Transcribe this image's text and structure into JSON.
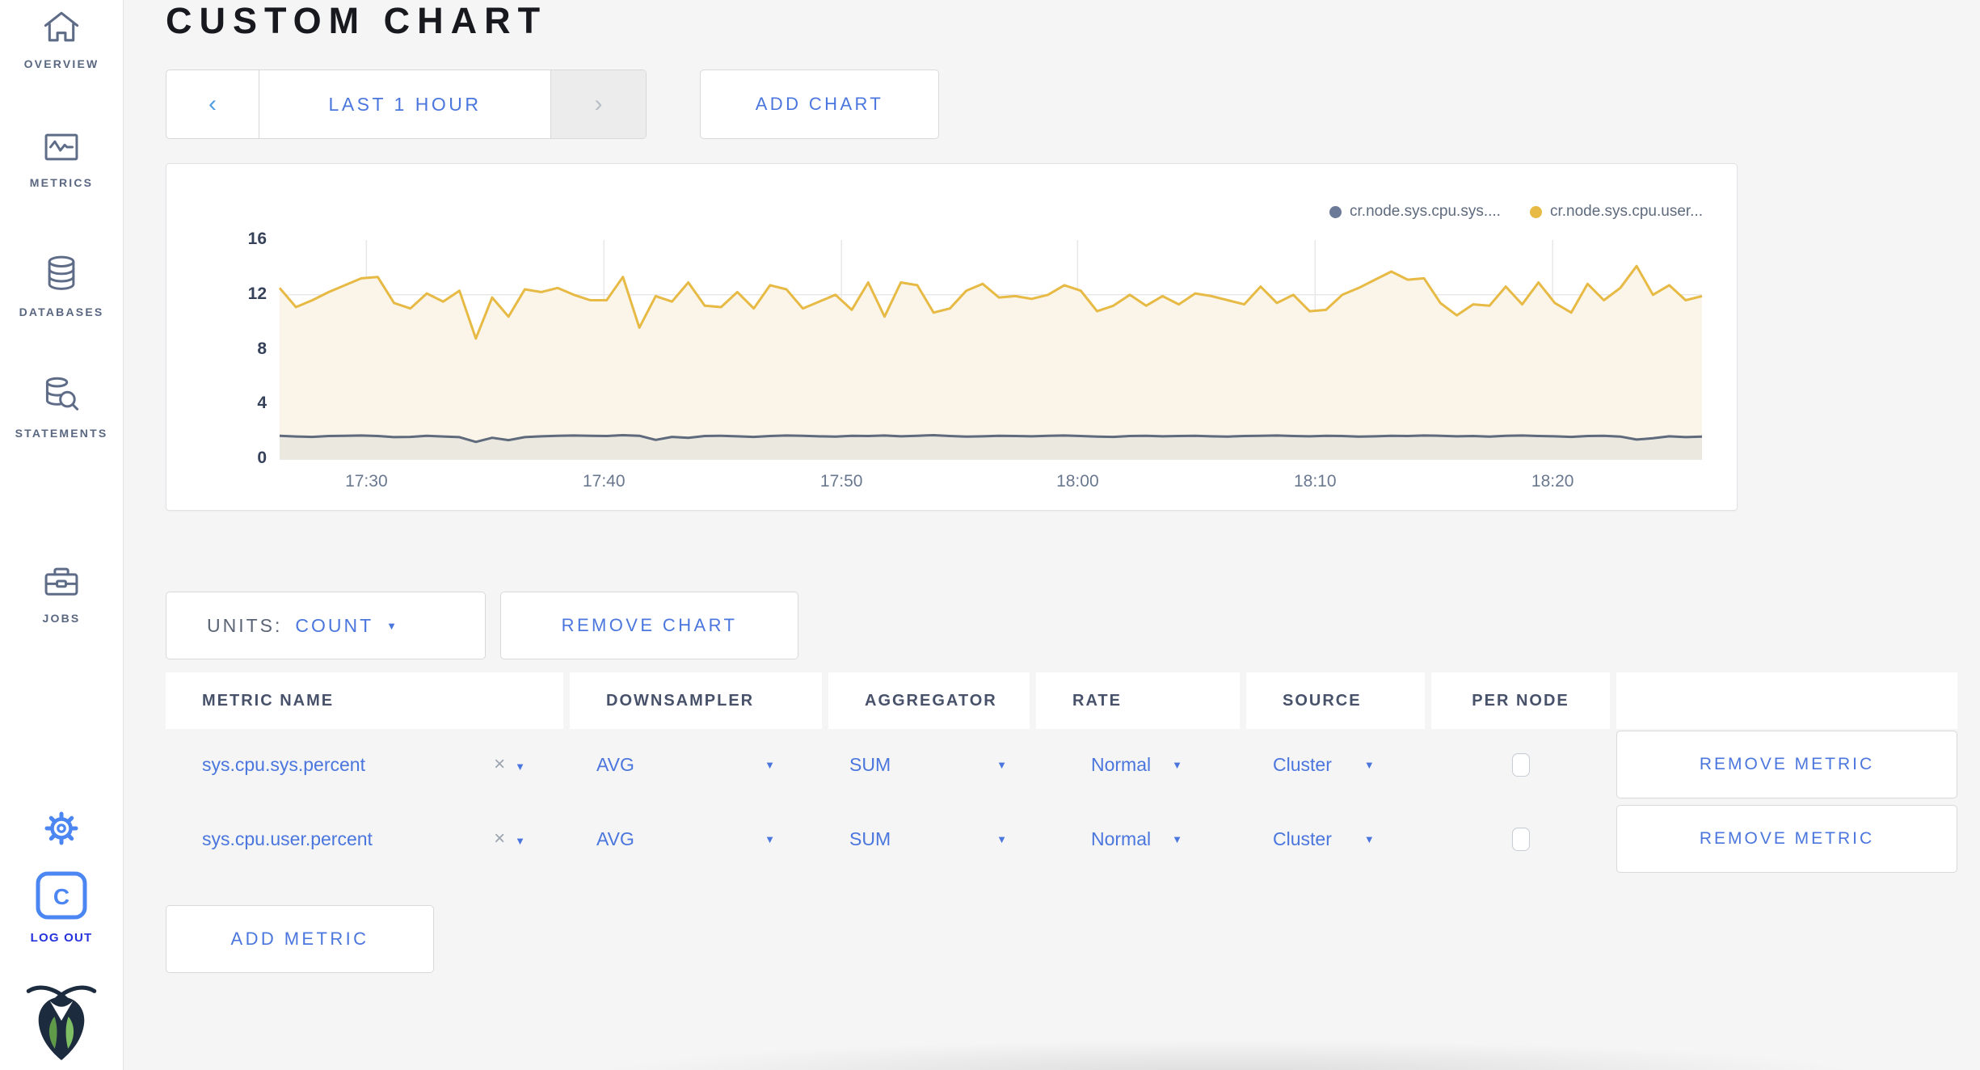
{
  "header": {
    "title": "CUSTOM CHART"
  },
  "sidebar": {
    "items": [
      {
        "label": "OVERVIEW"
      },
      {
        "label": "METRICS"
      },
      {
        "label": "DATABASES"
      },
      {
        "label": "STATEMENTS"
      },
      {
        "label": "JOBS"
      }
    ],
    "logout_label": "LOG OUT"
  },
  "icons": {
    "chevron_left": "‹",
    "chevron_right": "›",
    "caret_down": "▼",
    "close": "×",
    "logo_letter": "C"
  },
  "timebar": {
    "range_label": "LAST 1 HOUR",
    "add_chart_label": "ADD CHART"
  },
  "controls": {
    "units_label": "UNITS:",
    "units_value": "COUNT",
    "remove_chart_label": "REMOVE CHART",
    "add_metric_label": "ADD METRIC"
  },
  "table": {
    "headers": [
      "METRIC NAME",
      "DOWNSAMPLER",
      "AGGREGATOR",
      "RATE",
      "SOURCE",
      "PER NODE"
    ],
    "rows": [
      {
        "metric": "sys.cpu.sys.percent",
        "downsampler": "AVG",
        "aggregator": "SUM",
        "rate": "Normal",
        "source": "Cluster",
        "per_node_checked": false,
        "remove_label": "REMOVE METRIC"
      },
      {
        "metric": "sys.cpu.user.percent",
        "downsampler": "AVG",
        "aggregator": "SUM",
        "rate": "Normal",
        "source": "Cluster",
        "per_node_checked": false,
        "remove_label": "REMOVE METRIC"
      }
    ]
  },
  "chart_data": {
    "type": "area",
    "title": "",
    "xlabel": "",
    "ylabel": "",
    "ylim": [
      0,
      16
    ],
    "y_ticks": [
      0,
      4,
      8,
      12,
      16
    ],
    "x_ticks": [
      "17:30",
      "17:40",
      "17:50",
      "18:00",
      "18:10",
      "18:20"
    ],
    "x_tick_fracs": [
      0.061,
      0.228,
      0.395,
      0.561,
      0.728,
      0.895
    ],
    "grid": {
      "color": "#e8e8e8",
      "baseline_color": "#e2e0da"
    },
    "series": [
      {
        "name": "cr.node.sys.cpu.sys....",
        "color": "#5f6a7d",
        "fill": "#ebe8e0",
        "values": [
          1.7,
          1.65,
          1.62,
          1.68,
          1.7,
          1.72,
          1.68,
          1.6,
          1.62,
          1.7,
          1.65,
          1.6,
          1.25,
          1.55,
          1.38,
          1.6,
          1.66,
          1.7,
          1.72,
          1.7,
          1.68,
          1.74,
          1.7,
          1.4,
          1.62,
          1.55,
          1.68,
          1.7,
          1.66,
          1.62,
          1.68,
          1.72,
          1.7,
          1.66,
          1.64,
          1.7,
          1.68,
          1.72,
          1.66,
          1.7,
          1.74,
          1.68,
          1.64,
          1.66,
          1.7,
          1.68,
          1.66,
          1.7,
          1.72,
          1.68,
          1.64,
          1.62,
          1.68,
          1.7,
          1.66,
          1.68,
          1.7,
          1.66,
          1.64,
          1.68,
          1.7,
          1.72,
          1.68,
          1.66,
          1.7,
          1.68,
          1.64,
          1.66,
          1.7,
          1.68,
          1.72,
          1.7,
          1.66,
          1.68,
          1.64,
          1.7,
          1.72,
          1.68,
          1.66,
          1.62,
          1.68,
          1.7,
          1.64,
          1.42,
          1.52,
          1.66,
          1.6,
          1.64
        ]
      },
      {
        "name": "cr.node.sys.cpu.user...",
        "color": "#e7ba45",
        "fill": "#faf5e8",
        "values": [
          12.5,
          11.1,
          11.6,
          12.2,
          12.7,
          13.2,
          13.3,
          11.4,
          11.0,
          12.1,
          11.5,
          12.3,
          8.8,
          11.8,
          10.4,
          12.4,
          12.2,
          12.5,
          12.0,
          11.6,
          11.6,
          13.3,
          9.6,
          11.9,
          11.5,
          12.9,
          11.2,
          11.1,
          12.2,
          11.0,
          12.7,
          12.4,
          11.0,
          11.5,
          12.0,
          10.9,
          12.9,
          10.4,
          12.9,
          12.7,
          10.7,
          11.0,
          12.3,
          12.8,
          11.8,
          11.9,
          11.7,
          12.0,
          12.7,
          12.3,
          10.8,
          11.2,
          12.0,
          11.2,
          11.9,
          11.3,
          12.1,
          11.9,
          11.6,
          11.3,
          12.6,
          11.4,
          12.0,
          10.8,
          10.9,
          12.0,
          12.5,
          13.1,
          13.7,
          13.1,
          13.2,
          11.4,
          10.5,
          11.3,
          11.2,
          12.6,
          11.3,
          12.9,
          11.4,
          10.7,
          12.8,
          11.6,
          12.5,
          14.1,
          12.0,
          12.7,
          11.6,
          11.9
        ]
      }
    ],
    "legend_position": "top-right"
  }
}
